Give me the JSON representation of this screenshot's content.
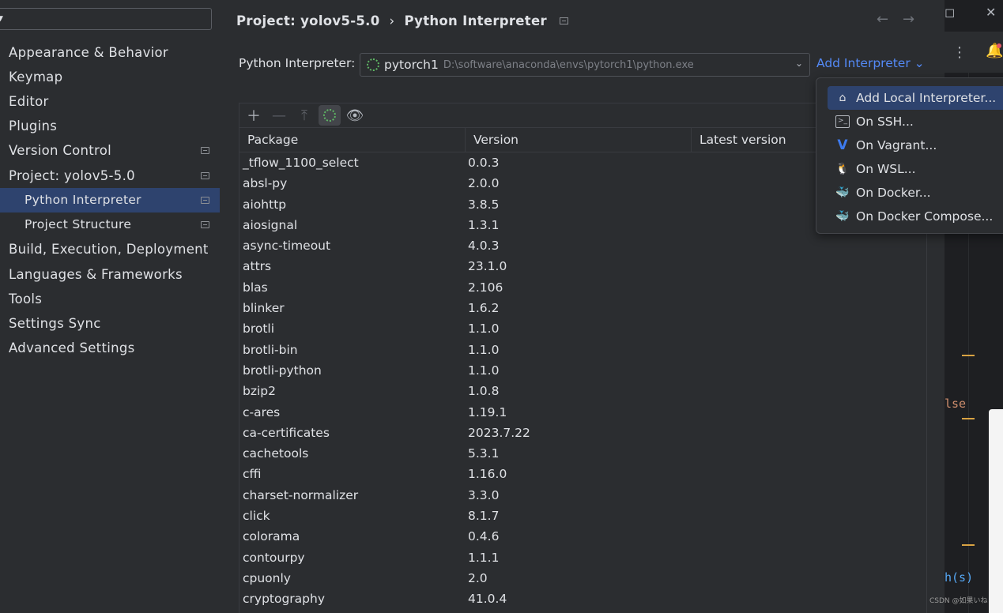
{
  "sidebar": {
    "items": [
      {
        "label": "Appearance & Behavior"
      },
      {
        "label": "Keymap"
      },
      {
        "label": "Editor"
      },
      {
        "label": "Plugins"
      },
      {
        "label": "Version Control"
      },
      {
        "label": "Project: yolov5-5.0"
      },
      {
        "label": "Python Interpreter"
      },
      {
        "label": "Project Structure"
      },
      {
        "label": "Build, Execution, Deployment"
      },
      {
        "label": "Languages & Frameworks"
      },
      {
        "label": "Tools"
      },
      {
        "label": "Settings Sync"
      },
      {
        "label": "Advanced Settings"
      }
    ]
  },
  "header": {
    "project": "Project: yolov5-5.0",
    "separator": "›",
    "page": "Python Interpreter",
    "back_icon": "←",
    "forward_icon": "→"
  },
  "interpreter": {
    "label": "Python Interpreter:",
    "name": "pytorch1",
    "path": "D:\\software\\anaconda\\envs\\pytorch1\\python.exe",
    "add_label": "Add Interpreter ⌄"
  },
  "table": {
    "columns": [
      "Package",
      "Version",
      "Latest version"
    ],
    "rows": [
      [
        "_tflow_1100_select",
        "0.0.3"
      ],
      [
        "absl-py",
        "2.0.0"
      ],
      [
        "aiohttp",
        "3.8.5"
      ],
      [
        "aiosignal",
        "1.3.1"
      ],
      [
        "async-timeout",
        "4.0.3"
      ],
      [
        "attrs",
        "23.1.0"
      ],
      [
        "blas",
        "2.106"
      ],
      [
        "blinker",
        "1.6.2"
      ],
      [
        "brotli",
        "1.1.0"
      ],
      [
        "brotli-bin",
        "1.1.0"
      ],
      [
        "brotli-python",
        "1.1.0"
      ],
      [
        "bzip2",
        "1.0.8"
      ],
      [
        "c-ares",
        "1.19.1"
      ],
      [
        "ca-certificates",
        "2023.7.22"
      ],
      [
        "cachetools",
        "5.3.1"
      ],
      [
        "cffi",
        "1.16.0"
      ],
      [
        "charset-normalizer",
        "3.3.0"
      ],
      [
        "click",
        "8.1.7"
      ],
      [
        "colorama",
        "0.4.6"
      ],
      [
        "contourpy",
        "1.1.1"
      ],
      [
        "cpuonly",
        "2.0"
      ],
      [
        "cryptography",
        "41.0.4"
      ]
    ]
  },
  "popup": {
    "items": [
      {
        "label": "Add Local Interpreter...",
        "icon": "home-icon"
      },
      {
        "label": "On SSH...",
        "icon": "terminal-icon"
      },
      {
        "label": "On Vagrant...",
        "icon": "vagrant-icon"
      },
      {
        "label": "On WSL...",
        "icon": "linux-icon"
      },
      {
        "label": "On Docker...",
        "icon": "docker-icon"
      },
      {
        "label": "On Docker Compose...",
        "icon": "docker-compose-icon"
      }
    ]
  },
  "editor": {
    "code_else": "lse",
    "code_h": "h(s)",
    "watermark": "CSDN @如果いね"
  },
  "colors": {
    "background": "#2b2d30",
    "selection": "#2e436e",
    "link": "#548af7",
    "accent_orange": "#d9a343"
  }
}
